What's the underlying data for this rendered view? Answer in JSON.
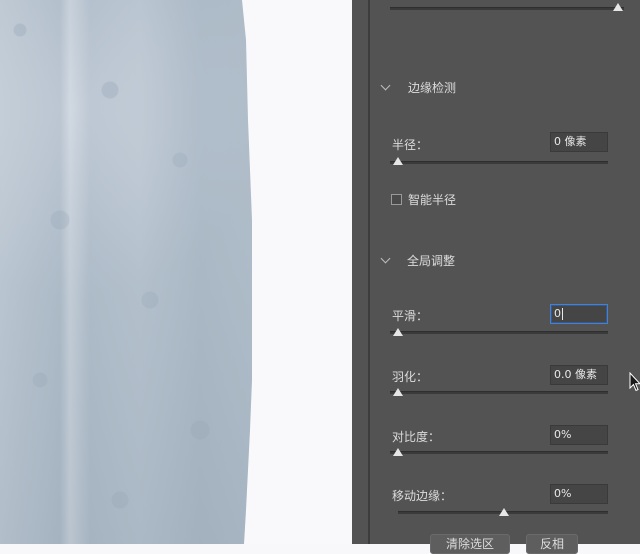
{
  "edge_detection": {
    "title": "边缘检测",
    "radius_label": "半径：",
    "radius_value": "0 像素",
    "smart_radius_label": "智能半径",
    "smart_radius_checked": false
  },
  "global_refine": {
    "title": "全局调整",
    "smooth_label": "平滑：",
    "smooth_value": "0",
    "feather_label": "羽化：",
    "feather_value": "0.0 像素",
    "contrast_label": "对比度：",
    "contrast_value": "0%",
    "shift_edge_label": "移动边缘：",
    "shift_edge_value": "0%"
  },
  "footer": {
    "clear_selection_label": "清除选区",
    "invert_label": "反相"
  },
  "colors": {
    "panel_bg": "#535353",
    "field_bg": "#454545",
    "focus_border": "#4d7fc5"
  }
}
